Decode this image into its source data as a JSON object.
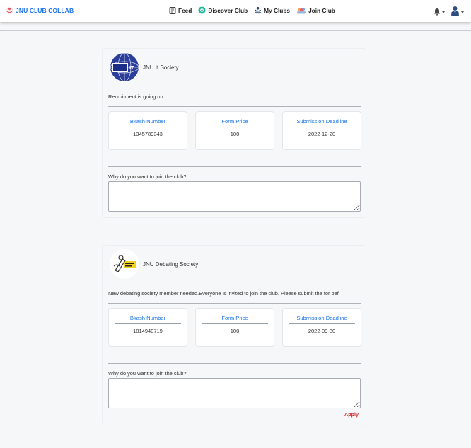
{
  "brand": {
    "name": "JNU CLUB COLLAB"
  },
  "nav": {
    "items": [
      {
        "label": "Feed",
        "icon": "feed-icon"
      },
      {
        "label": "Discover Club",
        "icon": "discover-icon"
      },
      {
        "label": "My Clubs",
        "icon": "my-clubs-icon"
      },
      {
        "label": "Join Club",
        "icon": "join-club-icon"
      }
    ]
  },
  "posts": [
    {
      "club_name": "JNU It Society",
      "description": "Recruitment is going on.",
      "fields": [
        {
          "label": "Bkash Number",
          "value": "1345789343"
        },
        {
          "label": "Form Price",
          "value": "100"
        },
        {
          "label": "Submission Deadline",
          "value": "2022-12-20"
        }
      ],
      "question": "Why do you want to join the club?",
      "logo_caption": "JnuIT IT"
    },
    {
      "club_name": "JNU Debating Society",
      "description": "New debating society member needed.Everyone is invited to join the club. Please submit the for bef",
      "fields": [
        {
          "label": "Bkash Number",
          "value": "1814940719"
        },
        {
          "label": "Form Price",
          "value": "100"
        },
        {
          "label": "Submission Deadline",
          "value": "2022-09-30"
        }
      ],
      "question": "Why do you want to join the club?",
      "apply_label": "Apply"
    }
  ],
  "colors": {
    "accent": "#1a73e8",
    "apply": "#d0262c",
    "background": "#f6f7f9"
  }
}
